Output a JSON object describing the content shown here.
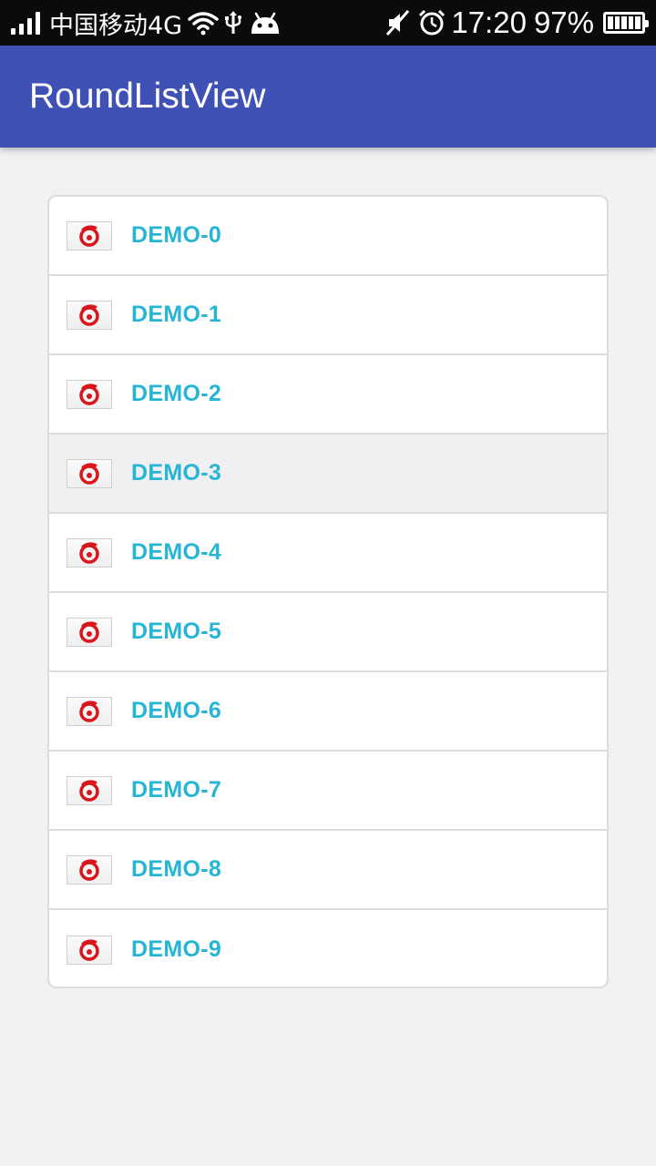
{
  "status_bar": {
    "carrier": "中国移动4G",
    "time": "17:20",
    "battery_percent": "97%",
    "battery_level": 0.97,
    "icons": [
      "signal-icon",
      "wifi-icon",
      "usb-icon",
      "android-icon",
      "mute-icon",
      "alarm-icon",
      "battery-icon"
    ]
  },
  "app_bar": {
    "title": "RoundListView",
    "color": "#3f51b5"
  },
  "list": {
    "label_color": "#27b5d6",
    "pressed_index": 3,
    "items": [
      {
        "label": "DEMO-0",
        "icon": "swirl-logo-icon"
      },
      {
        "label": "DEMO-1",
        "icon": "swirl-logo-icon"
      },
      {
        "label": "DEMO-2",
        "icon": "swirl-logo-icon"
      },
      {
        "label": "DEMO-3",
        "icon": "swirl-logo-icon"
      },
      {
        "label": "DEMO-4",
        "icon": "swirl-logo-icon"
      },
      {
        "label": "DEMO-5",
        "icon": "swirl-logo-icon"
      },
      {
        "label": "DEMO-6",
        "icon": "swirl-logo-icon"
      },
      {
        "label": "DEMO-7",
        "icon": "swirl-logo-icon"
      },
      {
        "label": "DEMO-8",
        "icon": "swirl-logo-icon"
      },
      {
        "label": "DEMO-9",
        "icon": "swirl-logo-icon"
      }
    ]
  }
}
